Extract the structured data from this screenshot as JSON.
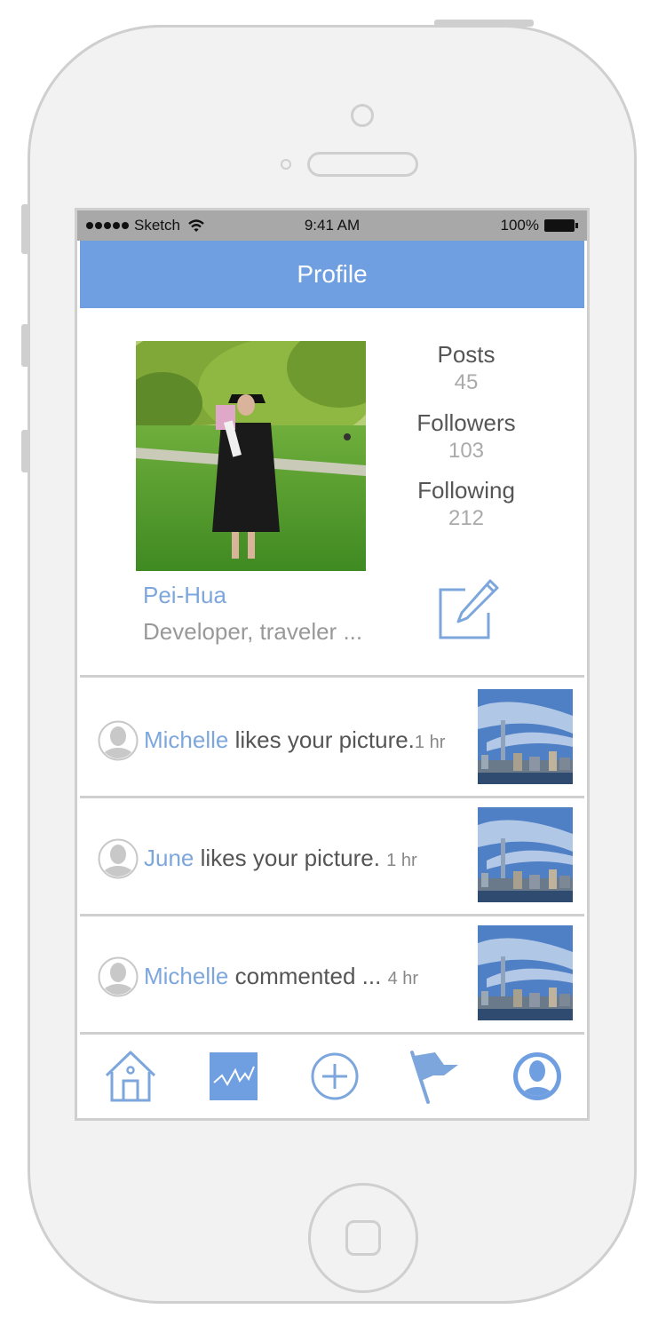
{
  "status_bar": {
    "carrier": "Sketch",
    "time": "9:41 AM",
    "battery": "100%"
  },
  "nav": {
    "title": "Profile"
  },
  "profile": {
    "name": "Pei-Hua",
    "bio": "Developer, traveler ...",
    "stats": [
      {
        "label": "Posts",
        "value": "45"
      },
      {
        "label": "Followers",
        "value": "103"
      },
      {
        "label": "Following",
        "value": "212"
      }
    ]
  },
  "notifications": [
    {
      "who": "Michelle",
      "action": "likes your picture.",
      "time": "1 hr"
    },
    {
      "who": "June",
      "action": "likes your picture.",
      "time": "1 hr"
    },
    {
      "who": "Michelle",
      "action": "commented ...",
      "time": "4 hr"
    }
  ],
  "tabbar": {
    "icons": [
      "home-icon",
      "activity-icon",
      "add-icon",
      "flag-icon",
      "profile-icon"
    ]
  },
  "colors": {
    "accent": "#6f9fe0",
    "link": "#7da7dc",
    "status_bar": "#a8a8a8",
    "frame": "#cfcfcf"
  }
}
